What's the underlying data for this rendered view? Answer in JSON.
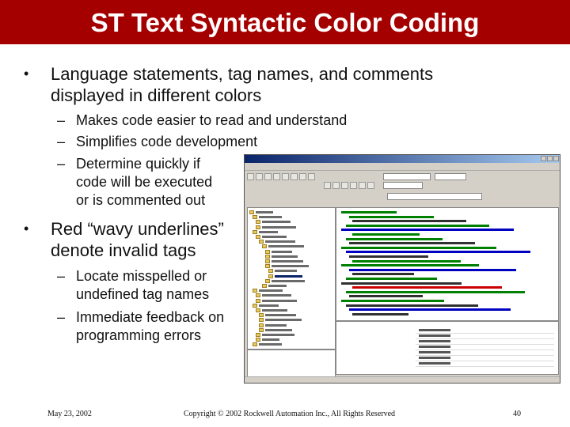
{
  "slide": {
    "title": "ST Text Syntactic Color Coding",
    "bullets": [
      {
        "text": "Language statements, tag names, and comments displayed in different colors",
        "subs": [
          "Makes code easier to read and understand",
          "Simplifies code development",
          "Determine quickly if code will be executed or is commented out"
        ]
      },
      {
        "text": "Red “wavy underlines” denote invalid tags",
        "subs": [
          "Locate misspelled or undefined tag names",
          "Immediate feedback on programming errors"
        ]
      }
    ],
    "bullet_glyph": "•",
    "sub_glyph": "–"
  },
  "footer": {
    "date": "May 23, 2002",
    "copyright": "Copyright © 2002 Rockwell Automation Inc., All Rights Reserved",
    "page": "40"
  },
  "colors": {
    "title_bar": "#a50000",
    "title_text": "#ffffff",
    "code_keyword": "#0000c0",
    "code_comment": "#008000",
    "code_text": "#303030",
    "code_invalid": "#cc0000"
  },
  "screenshot": {
    "icons": [
      "minimize-icon",
      "maximize-icon",
      "close-icon",
      "folder-icon",
      "tag-icon",
      "routine-icon"
    ]
  }
}
